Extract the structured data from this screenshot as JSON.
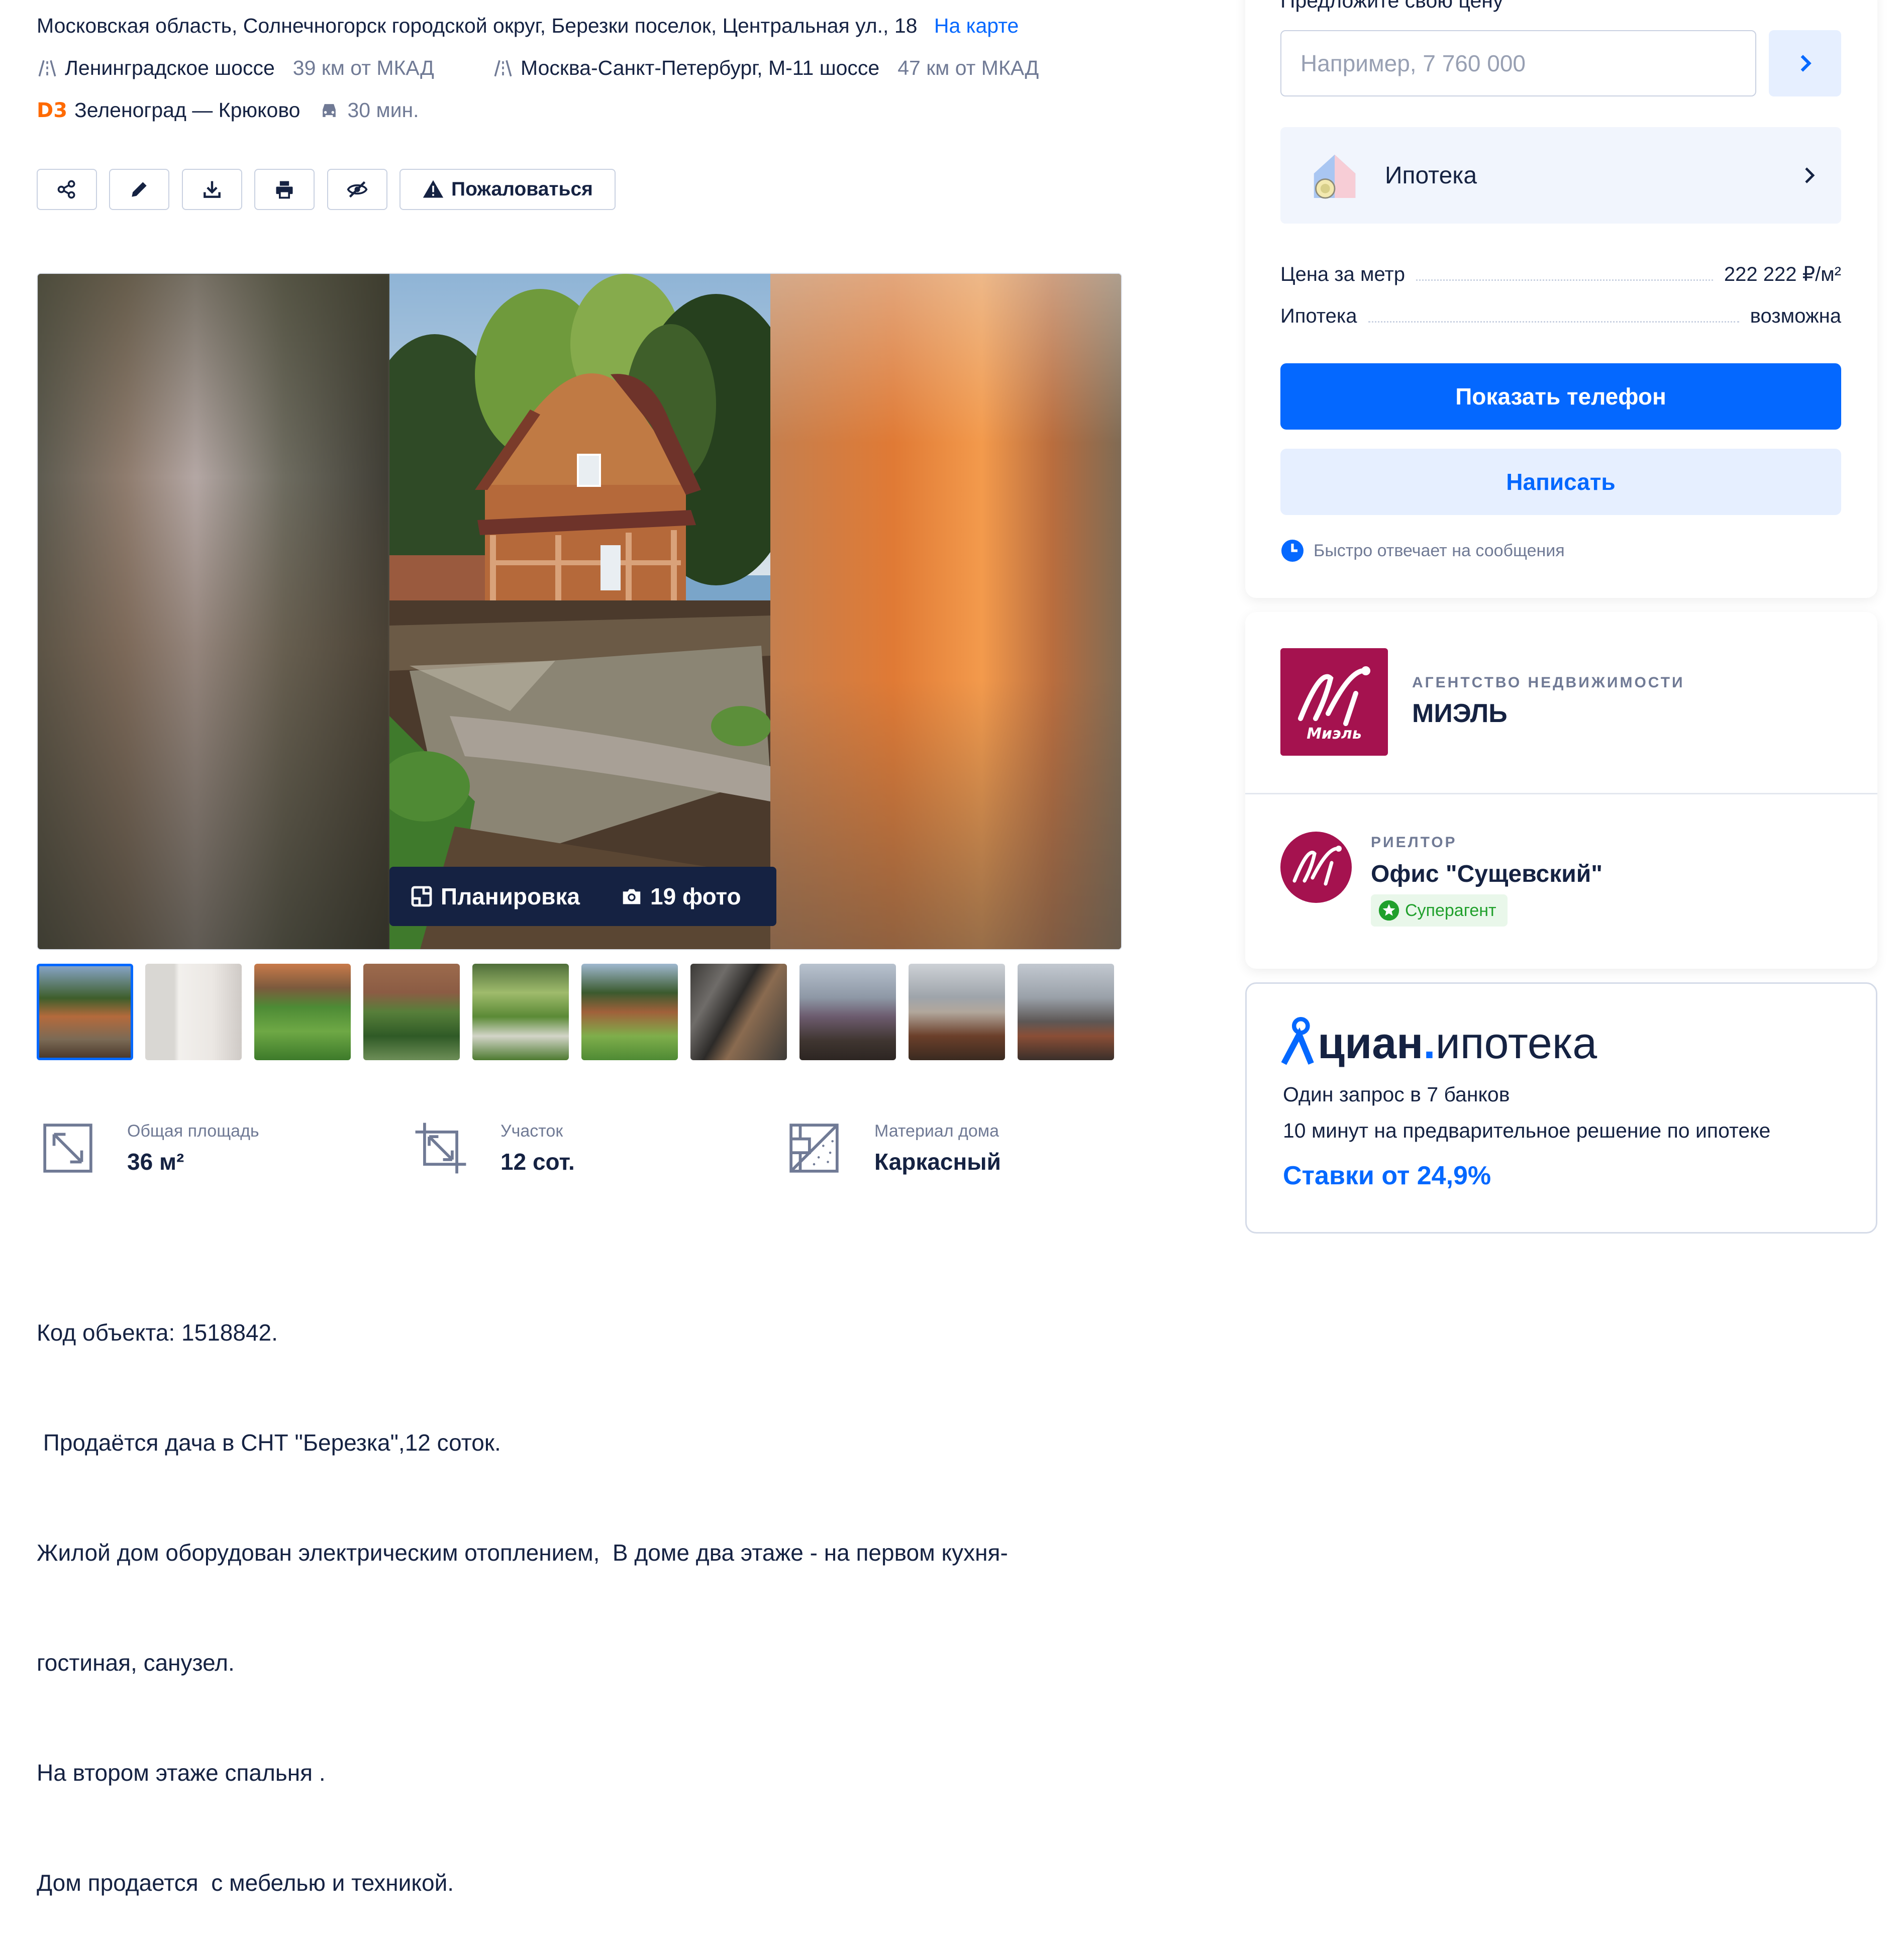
{
  "location": {
    "address": "Московская область, Солнечногорск городской округ, Березки поселок, Центральная ул., 18",
    "map_link": "На карте",
    "highways": [
      {
        "name": "Ленинградское шоссе",
        "distance": "39 км от МКАД"
      },
      {
        "name": "Москва-Санкт-Петербург, М-11 шоссе",
        "distance": "47 км от МКАД"
      }
    ],
    "metro": {
      "line": "D3",
      "name": "Зеленоград — Крюково",
      "time": "30 мин."
    }
  },
  "toolbar": {
    "icons": [
      "share-icon",
      "edit-icon",
      "download-icon",
      "print-icon",
      "hide-icon"
    ],
    "complain_label": "Пожаловаться"
  },
  "gallery": {
    "plan_label": "Планировка",
    "photos_label": "19 фото",
    "thumbnail_count": 10,
    "active_thumbnail": 0
  },
  "features": [
    {
      "label": "Общая площадь",
      "value": "36 м²",
      "icon": "area-icon"
    },
    {
      "label": "Участок",
      "value": "12 сот.",
      "icon": "land-plot-icon"
    },
    {
      "label": "Материал дома",
      "value": "Каркасный",
      "icon": "material-icon"
    }
  ],
  "description": [
    "Код объекта: 1518842.",
    " Продаётся дача в СНТ \"Березка\",12 соток.",
    "Жилой дом оборудован электрическим отоплением,  В доме два этаже - на первом кухня-",
    "гостиная, санузел.",
    "На втором этаже спальня .",
    "Дом продается  с мебелью и техникой."
  ],
  "offer": {
    "label": "Предложите свою цену",
    "placeholder": "Например, 7 760 000",
    "mortgage_label": "Ипотека",
    "price_per_meter_label": "Цена за метр",
    "price_per_meter_value": "222 222 ₽/м²",
    "mortgage_key": "Ипотека",
    "mortgage_value": "возможна",
    "show_phone": "Показать телефон",
    "write": "Написать",
    "fast_reply": "Быстро отвечает на сообщения"
  },
  "agency": {
    "type": "АГЕНТСТВО НЕДВИЖИМОСТИ",
    "name": "МИЭЛЬ",
    "logo_text": "Миэль"
  },
  "realtor": {
    "role": "РИЕЛТОР",
    "name": "Офис \"Сущевский\"",
    "badge": "Суперагент"
  },
  "cian_mortgage": {
    "logo_main": "циан",
    "logo_dot": ".",
    "logo_sub": "ипотека",
    "line1": "Один запрос в 7 банков",
    "line2": "10 минут на предварительное решение по ипотеке",
    "rates": "Ставки от 24,9%"
  },
  "colors": {
    "accent": "#0468ff",
    "text": "#152242",
    "muted": "#707a95",
    "agency_brand": "#a5124f",
    "metro_d3": "#ff6a00",
    "success": "#20a02c"
  }
}
